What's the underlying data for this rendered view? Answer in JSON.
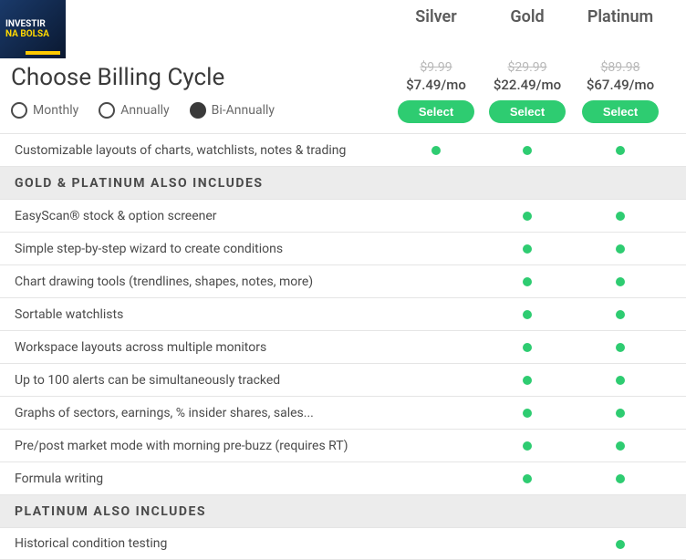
{
  "logo": {
    "line1": "INVESTIR",
    "line2": "NA BOLSA"
  },
  "page_title": "Choose Billing Cycle",
  "billing_cycles": [
    {
      "label": "Monthly",
      "selected": false
    },
    {
      "label": "Annually",
      "selected": false
    },
    {
      "label": "Bi-Annually",
      "selected": true
    }
  ],
  "tiers": [
    {
      "name": "Silver",
      "strike_price": "$9.99",
      "price": "$7.49/mo",
      "select_label": "Select"
    },
    {
      "name": "Gold",
      "strike_price": "$29.99",
      "price": "$22.49/mo",
      "select_label": "Select"
    },
    {
      "name": "Platinum",
      "strike_price": "$89.98",
      "price": "$67.49/mo",
      "select_label": "Select"
    }
  ],
  "rows": [
    {
      "type": "feature",
      "label": "Customizable layouts of charts, watchlists, notes & trading",
      "tiers": [
        true,
        true,
        true
      ]
    },
    {
      "type": "section",
      "label": "GOLD & PLATINUM ALSO INCLUDES"
    },
    {
      "type": "feature",
      "label": "EasyScan® stock & option screener",
      "tiers": [
        false,
        true,
        true
      ]
    },
    {
      "type": "feature",
      "label": "Simple step-by-step wizard to create conditions",
      "tiers": [
        false,
        true,
        true
      ]
    },
    {
      "type": "feature",
      "label": "Chart drawing tools (trendlines, shapes, notes, more)",
      "tiers": [
        false,
        true,
        true
      ]
    },
    {
      "type": "feature",
      "label": "Sortable watchlists",
      "tiers": [
        false,
        true,
        true
      ]
    },
    {
      "type": "feature",
      "label": "Workspace layouts across multiple monitors",
      "tiers": [
        false,
        true,
        true
      ]
    },
    {
      "type": "feature",
      "label": "Up to 100 alerts can be simultaneously tracked",
      "tiers": [
        false,
        true,
        true
      ]
    },
    {
      "type": "feature",
      "label": "Graphs of sectors, earnings, % insider shares, sales...",
      "tiers": [
        false,
        true,
        true
      ]
    },
    {
      "type": "feature",
      "label": "Pre/post market mode with morning pre-buzz (requires RT)",
      "tiers": [
        false,
        true,
        true
      ]
    },
    {
      "type": "feature",
      "label": "Formula writing",
      "tiers": [
        false,
        true,
        true
      ]
    },
    {
      "type": "section",
      "label": "PLATINUM ALSO INCLUDES"
    },
    {
      "type": "feature",
      "label": "Historical condition testing",
      "tiers": [
        false,
        false,
        true
      ]
    }
  ]
}
